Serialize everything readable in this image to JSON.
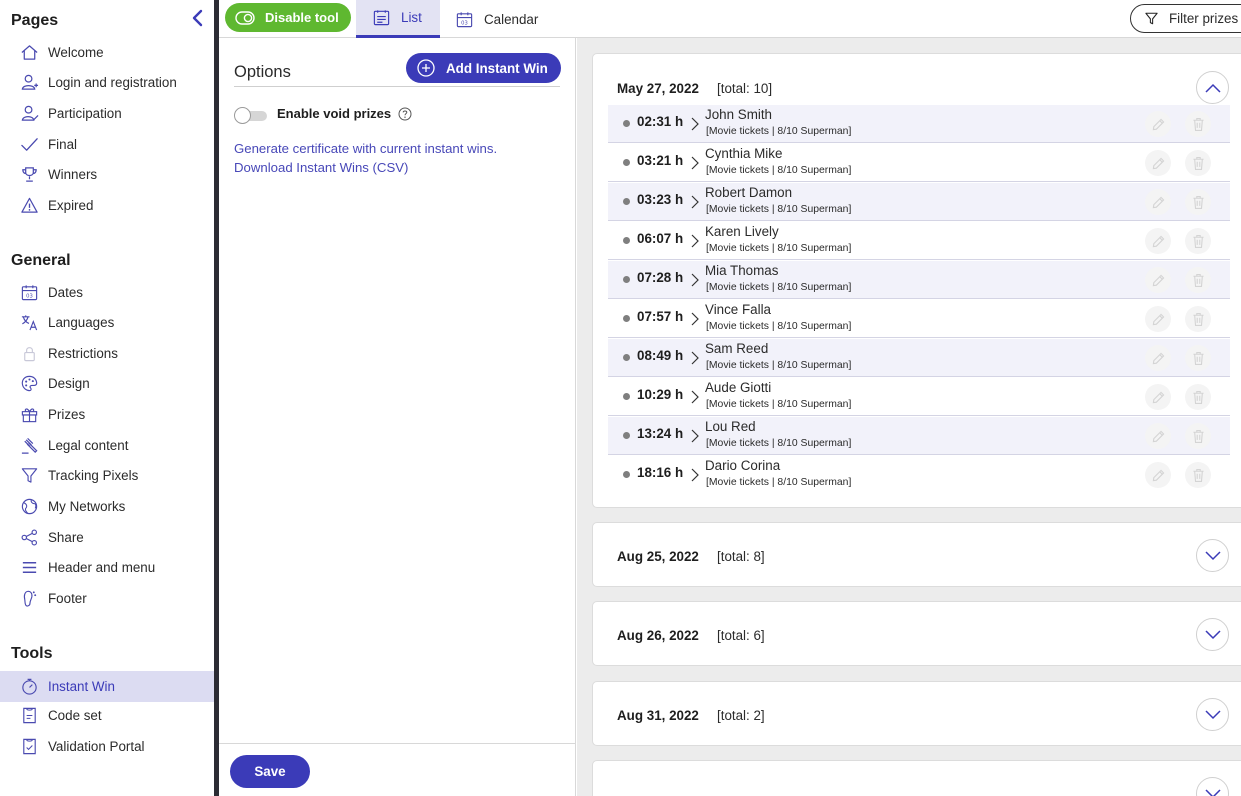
{
  "sidebar": {
    "collapse_icon": "chevron-left-icon",
    "pages_heading": "Pages",
    "pages": [
      {
        "label": "Welcome",
        "icon": "home-icon"
      },
      {
        "label": "Login and registration",
        "icon": "user-add-icon"
      },
      {
        "label": "Participation",
        "icon": "user-edit-icon"
      },
      {
        "label": "Final",
        "icon": "check-icon"
      },
      {
        "label": "Winners",
        "icon": "trophy-icon"
      },
      {
        "label": "Expired",
        "icon": "warning-icon"
      }
    ],
    "general_heading": "General",
    "general": [
      {
        "label": "Dates",
        "icon": "calendar-icon"
      },
      {
        "label": "Languages",
        "icon": "translate-icon"
      },
      {
        "label": "Restrictions",
        "icon": "lock-icon"
      },
      {
        "label": "Design",
        "icon": "palette-icon"
      },
      {
        "label": "Prizes",
        "icon": "gift-icon"
      },
      {
        "label": "Legal content",
        "icon": "gavel-icon"
      },
      {
        "label": "Tracking Pixels",
        "icon": "filter-icon"
      },
      {
        "label": "My Networks",
        "icon": "globe-icon"
      },
      {
        "label": "Share",
        "icon": "share-icon"
      },
      {
        "label": "Header and menu",
        "icon": "menu-icon"
      },
      {
        "label": "Footer",
        "icon": "footer-icon"
      }
    ],
    "tools_heading": "Tools",
    "tools": [
      {
        "label": "Instant Win",
        "icon": "stopwatch-icon",
        "active": true
      },
      {
        "label": "Code set",
        "icon": "ticket-icon"
      },
      {
        "label": "Validation Portal",
        "icon": "validation-icon"
      }
    ]
  },
  "topbar": {
    "disable_label": "Disable tool",
    "tabs": [
      {
        "label": "List",
        "icon": "list-icon",
        "active": true
      },
      {
        "label": "Calendar",
        "icon": "calendar-icon"
      }
    ],
    "filter_label": "Filter prizes",
    "filter_icon": "filter-icon"
  },
  "options": {
    "title": "Options",
    "add_label": "Add Instant Win",
    "add_icon": "plus-circle-icon",
    "void_label": "Enable void prizes",
    "void_enabled": false,
    "links": [
      "Generate certificate with current instant wins.",
      "Download Instant Wins (CSV)"
    ],
    "save_label": "Save"
  },
  "groups": [
    {
      "date": "May 27, 2022",
      "total": "[total: 10]",
      "expanded": true,
      "wins": [
        {
          "time": "02:31 h",
          "name": "John Smith",
          "detail": "[Movie tickets | 8/10 Superman]"
        },
        {
          "time": "03:21 h",
          "name": "Cynthia Mike",
          "detail": "[Movie tickets | 8/10 Superman]"
        },
        {
          "time": "03:23 h",
          "name": "Robert Damon",
          "detail": "[Movie tickets | 8/10 Superman]"
        },
        {
          "time": "06:07 h",
          "name": "Karen Lively",
          "detail": "[Movie tickets | 8/10 Superman]"
        },
        {
          "time": "07:28 h",
          "name": "Mia Thomas",
          "detail": "[Movie tickets | 8/10 Superman]"
        },
        {
          "time": "07:57 h",
          "name": "Vince Falla",
          "detail": "[Movie tickets | 8/10 Superman]"
        },
        {
          "time": "08:49 h",
          "name": "Sam Reed",
          "detail": "[Movie tickets | 8/10 Superman]"
        },
        {
          "time": "10:29 h",
          "name": "Aude Giotti",
          "detail": "[Movie tickets | 8/10 Superman]"
        },
        {
          "time": "13:24 h",
          "name": "Lou Red",
          "detail": "[Movie tickets | 8/10 Superman]"
        },
        {
          "time": "18:16 h",
          "name": "Dario Corina",
          "detail": "[Movie tickets | 8/10 Superman]"
        }
      ]
    },
    {
      "date": "Aug 25, 2022",
      "total": "[total: 8]",
      "expanded": false,
      "wins": []
    },
    {
      "date": "Aug 26, 2022",
      "total": "[total: 6]",
      "expanded": false,
      "wins": []
    },
    {
      "date": "Aug 31, 2022",
      "total": "[total: 2]",
      "expanded": false,
      "wins": []
    }
  ],
  "colors": {
    "accent": "#3b3bb8",
    "toggle_on": "#5fb830",
    "link": "#4848b8"
  }
}
